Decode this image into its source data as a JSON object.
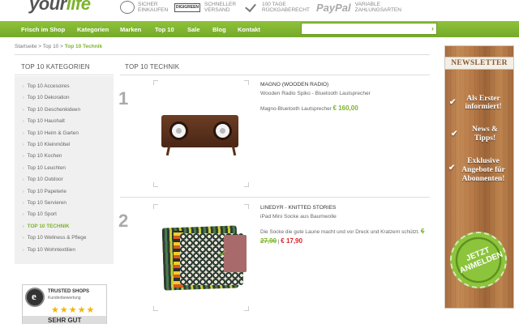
{
  "header": {
    "logo_main": "your",
    "logo_accent": "life",
    "usps": [
      {
        "line1": "SICHER",
        "line2": "EINKAUFEN"
      },
      {
        "line1": "SCHNELLER",
        "line2": "VERSAND",
        "box": "DIGIGREEN"
      },
      {
        "line1": "100 TAGE",
        "line2": "RÜCKGABERECHT"
      },
      {
        "brand": "PayPal",
        "line1": "VARIABLE",
        "line2": "ZAHLUNGSARTEN"
      }
    ]
  },
  "nav": {
    "items": [
      "Frisch im Shop",
      "Kategorien",
      "Marken",
      "Top 10",
      "Sale",
      "Blog",
      "Kontakt"
    ],
    "search_value": "",
    "search_icon": "chevron-right-icon"
  },
  "breadcrumb": {
    "items": [
      "Startseite",
      "Top 10",
      "Top 10 Technik"
    ],
    "separator": ">"
  },
  "sidebar": {
    "title": "TOP 10 KATEGORIEN",
    "items": [
      {
        "label": "Top 10 Accesoires"
      },
      {
        "label": "Top 10 Dekoration"
      },
      {
        "label": "Top 10 Geschenkideen"
      },
      {
        "label": "Top 10 Haushalt"
      },
      {
        "label": "Top 10 Heim & Garten"
      },
      {
        "label": "Top 10 Kleinmöbel"
      },
      {
        "label": "Top 10 Kochen"
      },
      {
        "label": "Top 10 Leuchten"
      },
      {
        "label": "Top 10 Outdoor"
      },
      {
        "label": "Top 10 Papeterie"
      },
      {
        "label": "Top 10 Servieren"
      },
      {
        "label": "Top 10 Sport"
      },
      {
        "label": "TOP 10 TECHNIK",
        "active": true
      },
      {
        "label": "Top 10 Wellness & Pflege"
      },
      {
        "label": "Top 10 Wohntextilien"
      }
    ]
  },
  "trusted_shops": {
    "name": "TRUSTED SHOPS",
    "sub": "Kundenbewertung",
    "stars": "★★★★★",
    "grade": "SEHR GUT"
  },
  "main": {
    "title": "TOP 10 TECHNIK",
    "products": [
      {
        "rank": "1",
        "title": "MAGNO (WOODEN RADIO)",
        "subtitle": "Wooden Radio Spiko - Bluetooth Lautsprecher",
        "desc": "Magno-Bluetooth Lautsprecher",
        "price": "€ 160,00"
      },
      {
        "rank": "2",
        "title": "LINEDYR - KNITTED STORIES",
        "subtitle": "iPad Mini Socke aus Baumwolle",
        "desc": "Die Socke die gute Laune macht und vor Dreck und Kratzern schützt.",
        "old_price": "€ 27,90",
        "separator": "|",
        "price": "€ 17,90"
      }
    ]
  },
  "newsletter": {
    "title": "NEWSLETTER",
    "blocks": [
      {
        "lines": [
          "Als Erster",
          "informiert!"
        ]
      },
      {
        "lines": [
          "News &",
          "Tipps!"
        ]
      },
      {
        "lines": [
          "Exklusive",
          "Angebote für",
          "Abonnenten!"
        ]
      }
    ],
    "stamp": [
      "JETZT",
      "ANMELDEN"
    ]
  },
  "colors": {
    "accent": "#7cb32b",
    "sale": "#d8232a",
    "nav_bg": "#7fb42f"
  }
}
